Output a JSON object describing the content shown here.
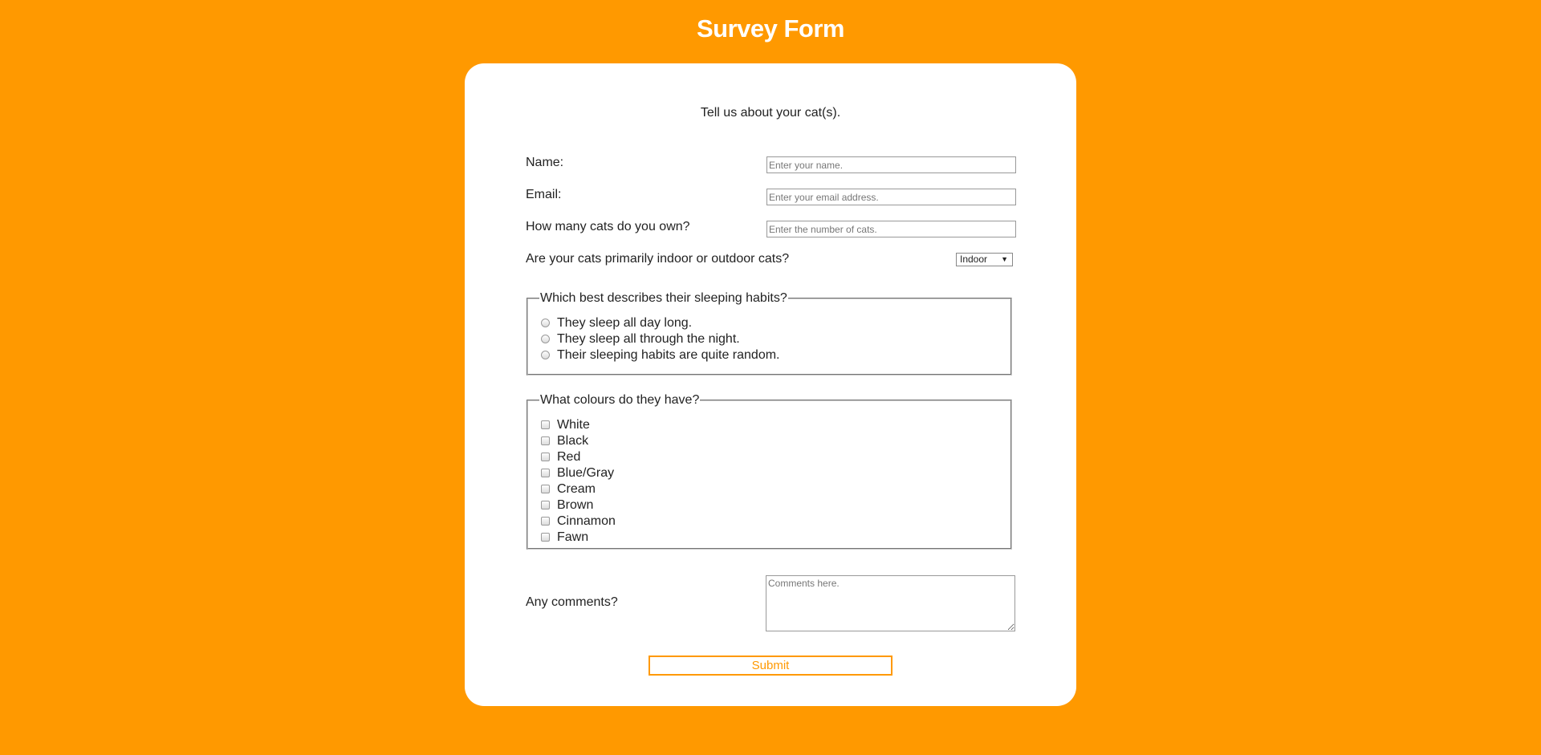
{
  "page": {
    "title": "Survey Form",
    "background_color": "#ff9900",
    "accent_color": "#ff9900"
  },
  "form": {
    "intro": "Tell us about your cat(s).",
    "name": {
      "label": "Name:",
      "placeholder": "Enter your name.",
      "value": ""
    },
    "email": {
      "label": "Email:",
      "placeholder": "Enter your email address.",
      "value": ""
    },
    "cat_count": {
      "label": "How many cats do you own?",
      "placeholder": "Enter the number of cats.",
      "value": ""
    },
    "indoor_outdoor": {
      "label": "Are your cats primarily indoor or outdoor cats?",
      "selected": "Indoor"
    },
    "sleeping": {
      "legend": "Which best describes their sleeping habits?",
      "options": [
        {
          "label": "They sleep all day long.",
          "checked": false
        },
        {
          "label": "They sleep all through the night.",
          "checked": false
        },
        {
          "label": "Their sleeping habits are quite random.",
          "checked": false
        }
      ]
    },
    "colours": {
      "legend": "What colours do they have?",
      "options": [
        {
          "label": "White",
          "checked": false
        },
        {
          "label": "Black",
          "checked": false
        },
        {
          "label": "Red",
          "checked": false
        },
        {
          "label": "Blue/Gray",
          "checked": false
        },
        {
          "label": "Cream",
          "checked": false
        },
        {
          "label": "Brown",
          "checked": false
        },
        {
          "label": "Cinnamon",
          "checked": false
        },
        {
          "label": "Fawn",
          "checked": false
        }
      ]
    },
    "comments": {
      "label": "Any comments?",
      "placeholder": "Comments here.",
      "value": ""
    },
    "submit_label": "Submit"
  }
}
